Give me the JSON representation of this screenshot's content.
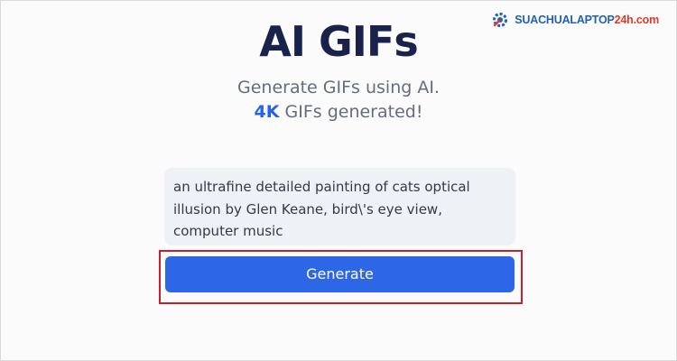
{
  "watermark": {
    "prefix": "SUACHUALAPTOP",
    "suffix": "24h.com",
    "icon": "gear-wrench-logo-icon"
  },
  "header": {
    "title": "AI GIFs",
    "subtitle": "Generate GIFs using AI.",
    "count": "4K",
    "count_suffix": " GIFs generated!"
  },
  "prompt": {
    "value": "an ultrafine detailed painting of cats optical illusion by Glen Keane, bird\\'s eye view, computer music"
  },
  "actions": {
    "generate_label": "Generate"
  },
  "colors": {
    "title": "#18224a",
    "accent": "#2563eb",
    "button": "#2d66e6",
    "highlight": "#c4202e",
    "prompt_bg": "#eef1f5"
  }
}
